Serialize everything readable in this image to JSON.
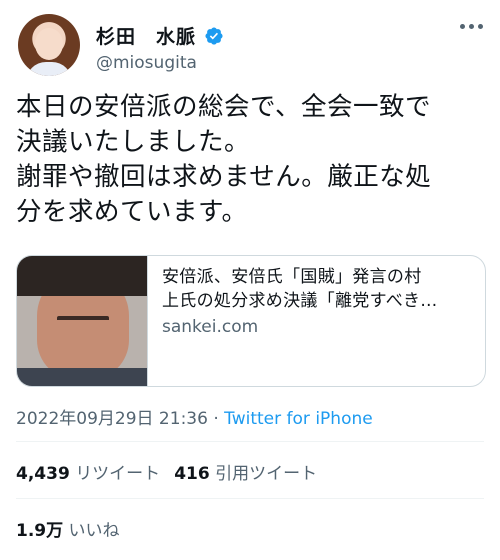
{
  "tweet": {
    "display_name": "杉田　水脈",
    "handle": "@miosugita",
    "text": "本日の安倍派の総会で、全会一致で\n決議いたしました。\n謝罪や撤回は求めません。厳正な処\n分を求めています。",
    "timestamp": "2022年09月29日 21:36",
    "separator": "·",
    "source": "Twitter for iPhone"
  },
  "card": {
    "title_line1": "安倍派、安倍氏「国賊」発言の村",
    "title_line2": "上氏の処分求め決議「離党すべき…",
    "domain": "sankei.com"
  },
  "stats": {
    "retweets_count": "4,439",
    "retweets_label": "リツイート",
    "quotes_count": "416",
    "quotes_label": "引用ツイート",
    "likes_count": "1.9万",
    "likes_label": "いいね"
  },
  "icons": {
    "verified": "verified-badge-icon",
    "more": "more-options-icon"
  },
  "colors": {
    "link": "#1d9bf0",
    "secondary_text": "#536471",
    "primary_text": "#0f1419"
  }
}
